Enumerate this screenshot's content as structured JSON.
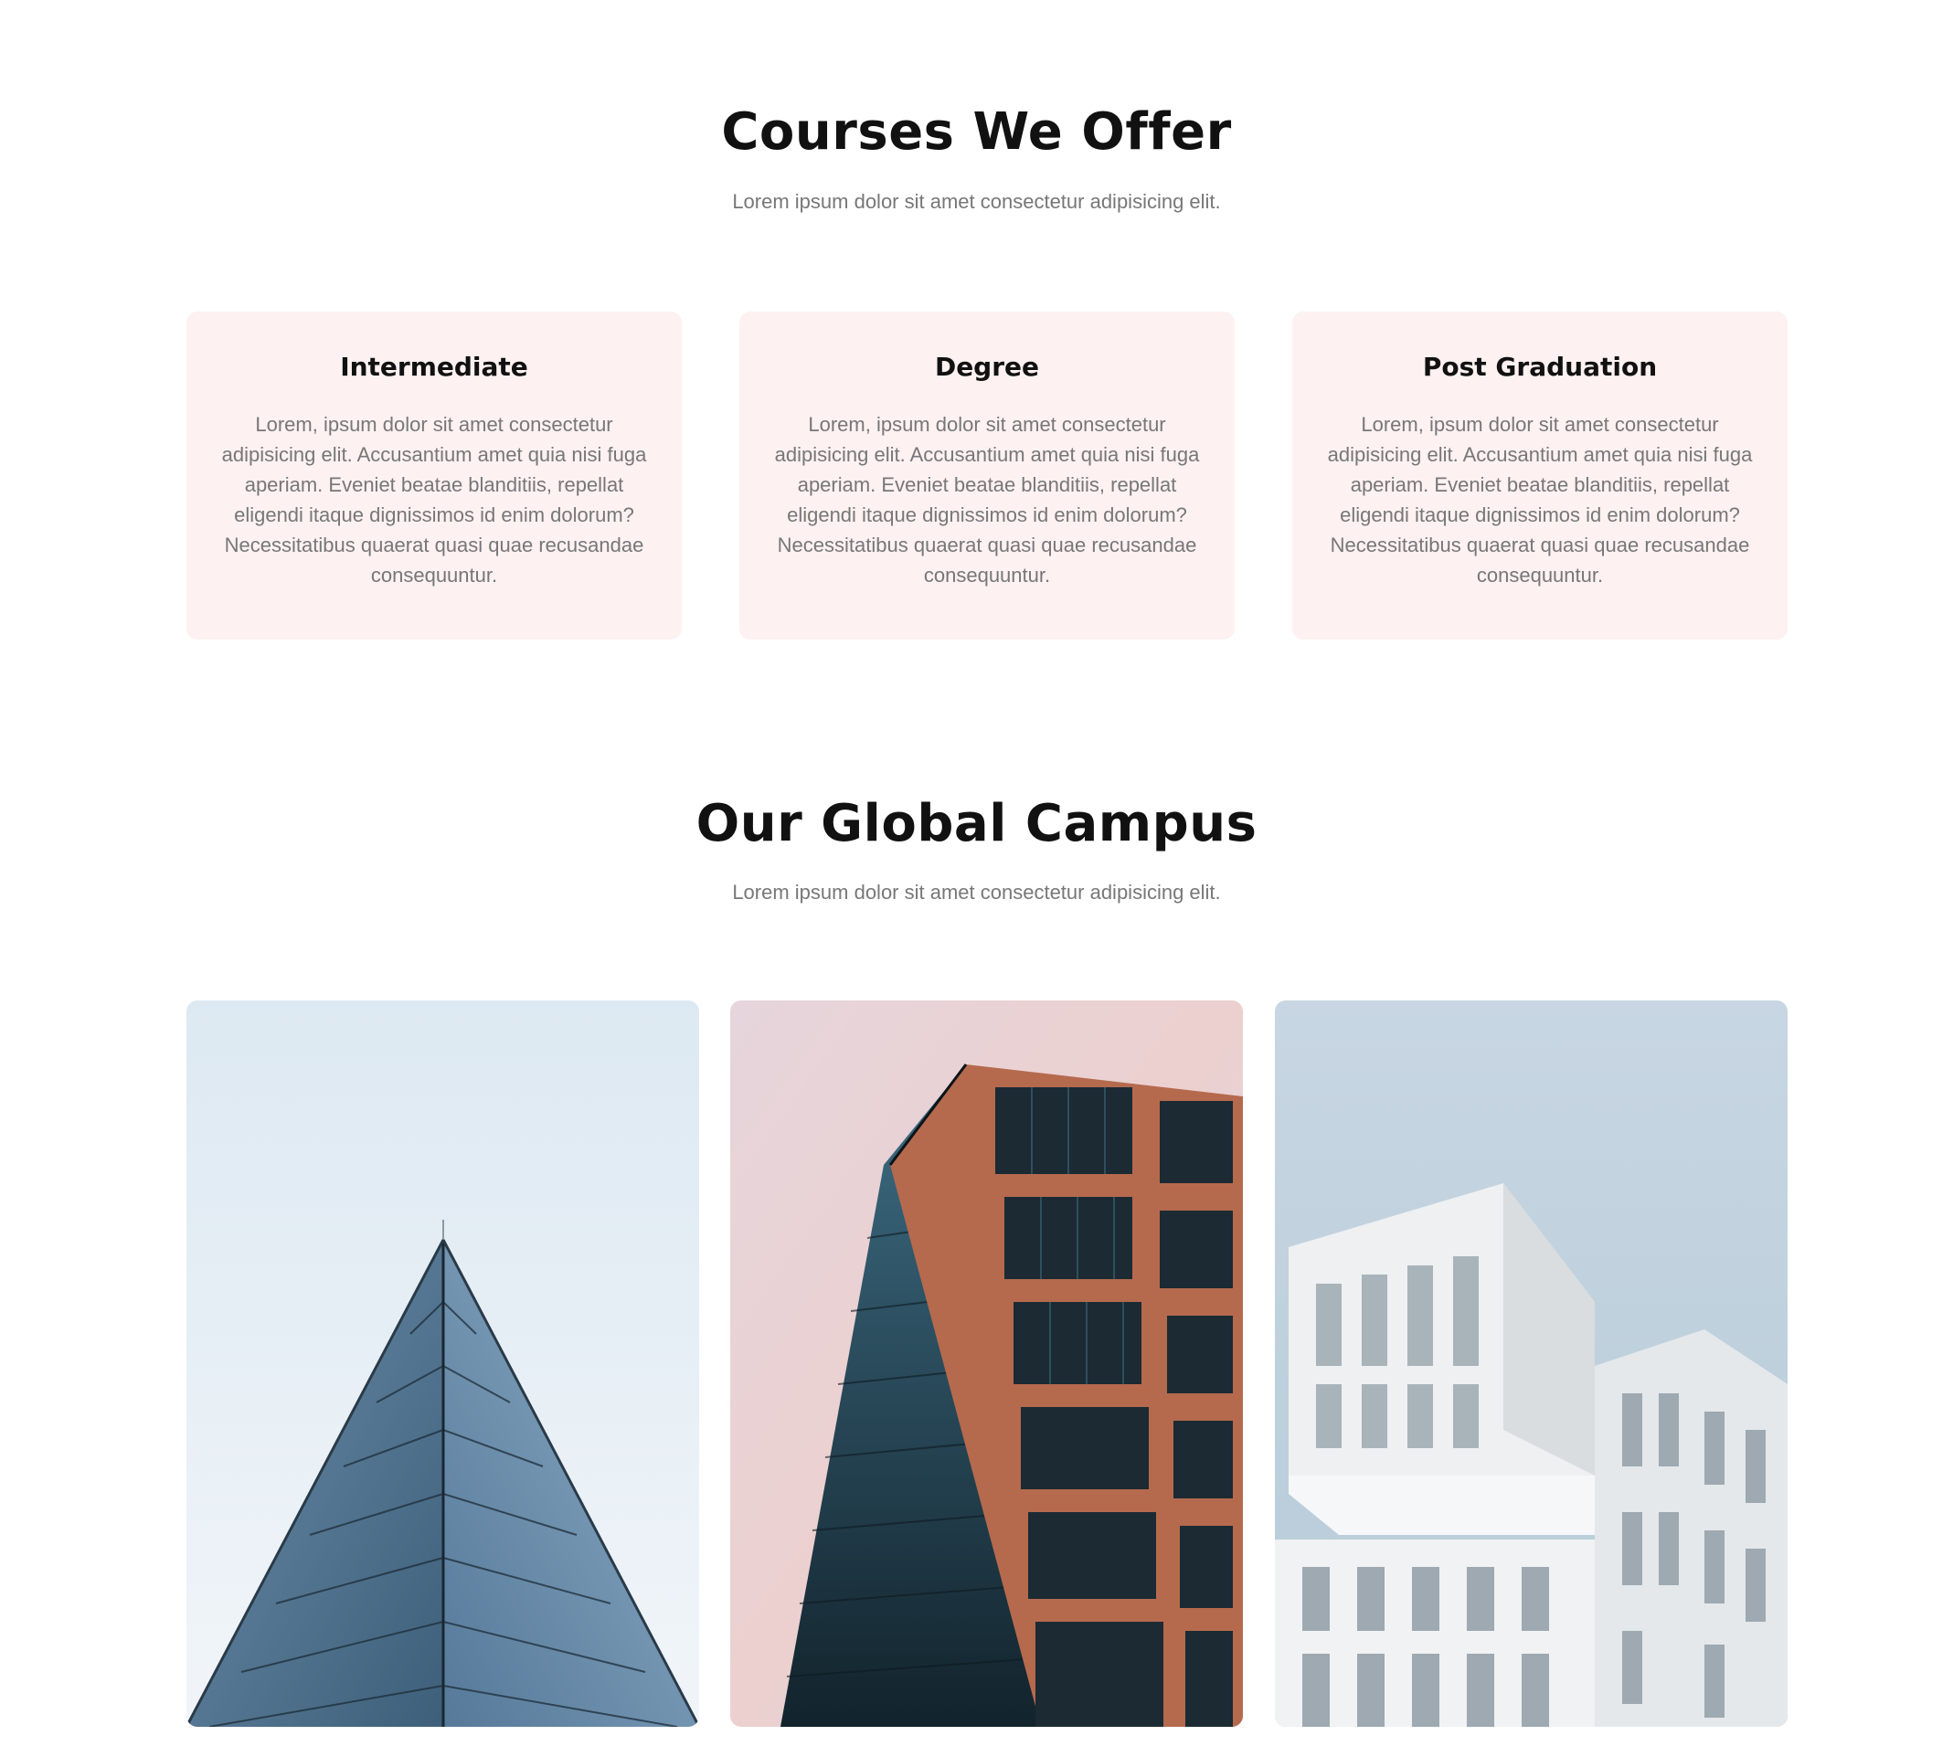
{
  "courses": {
    "title": "Courses We Offer",
    "subtitle": "Lorem ipsum dolor sit amet consectetur adipisicing elit.",
    "cards": [
      {
        "title": "Intermediate",
        "text": "Lorem, ipsum dolor sit amet consectetur adipisicing elit. Accusantium amet quia nisi fuga aperiam. Eveniet beatae blanditiis, repellat eligendi itaque dignissimos id enim dolorum? Necessitatibus quaerat quasi quae recusandae consequuntur."
      },
      {
        "title": "Degree",
        "text": "Lorem, ipsum dolor sit amet consectetur adipisicing elit. Accusantium amet quia nisi fuga aperiam. Eveniet beatae blanditiis, repellat eligendi itaque dignissimos id enim dolorum? Necessitatibus quaerat quasi quae recusandae consequuntur."
      },
      {
        "title": "Post Graduation",
        "text": "Lorem, ipsum dolor sit amet consectetur adipisicing elit. Accusantium amet quia nisi fuga aperiam. Eveniet beatae blanditiis, repellat eligendi itaque dignissimos id enim dolorum? Necessitatibus quaerat quasi quae recusandae consequuntur."
      }
    ]
  },
  "campus": {
    "title": "Our Global Campus",
    "subtitle": "Lorem ipsum dolor sit amet consectetur adipisicing elit.",
    "photos": [
      "glass-pyramid-building-photo",
      "glass-tower-building-photo",
      "white-building-photo"
    ]
  },
  "colors": {
    "card_background": "#fdf1f1",
    "heading": "#111111",
    "body_text": "#777777"
  }
}
